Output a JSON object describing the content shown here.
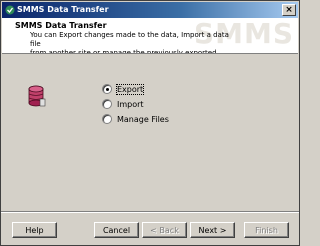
{
  "window": {
    "title": "SMMS Data Transfer",
    "close_glyph": "×"
  },
  "header": {
    "heading": "SMMS Data Transfer",
    "description": "You can Export changes made to the data, Import a data file\nfrom another site or manage the previously exported files",
    "watermark": "SMMS"
  },
  "options": [
    {
      "label": "Export",
      "checked": true
    },
    {
      "label": "Import",
      "checked": false
    },
    {
      "label": "Manage Files",
      "checked": false
    }
  ],
  "buttons": {
    "help": "Help",
    "cancel": "Cancel",
    "back": "< Back",
    "next": "Next >",
    "finish": "Finish"
  },
  "icons": {
    "app": "app-logo-icon",
    "database": "database-icon"
  }
}
